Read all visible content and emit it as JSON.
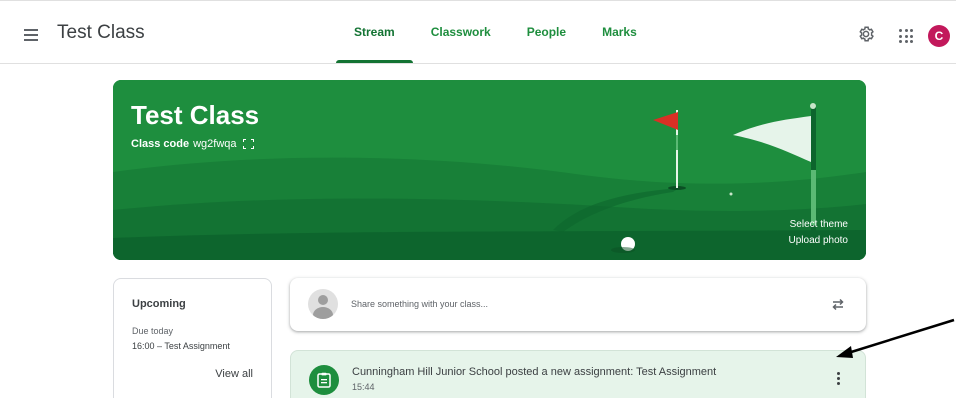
{
  "header": {
    "class_title": "Test Class",
    "tabs": [
      {
        "label": "Stream",
        "active": true
      },
      {
        "label": "Classwork",
        "active": false
      },
      {
        "label": "People",
        "active": false
      },
      {
        "label": "Marks",
        "active": false
      }
    ],
    "avatar_letter": "C",
    "icons": {
      "menu": "hamburger-menu-icon",
      "settings": "gear-icon",
      "apps": "apps-grid-icon"
    }
  },
  "banner": {
    "title": "Test Class",
    "class_code_label": "Class code",
    "class_code": "wg2fwqa",
    "select_theme": "Select theme",
    "upload_photo": "Upload photo"
  },
  "upcoming": {
    "title": "Upcoming",
    "due_label": "Due today",
    "items": [
      "16:00 – Test Assignment"
    ],
    "view_all": "View all"
  },
  "share": {
    "placeholder": "Share something with your class..."
  },
  "posts": [
    {
      "title": "Cunningham Hill Junior School posted a new assignment: Test Assignment",
      "time": "15:44"
    }
  ],
  "colors": {
    "accent": "#1e8e3e",
    "accent_dark": "#137333",
    "avatar": "#c2185b",
    "post_bg": "#e6f4ea"
  }
}
